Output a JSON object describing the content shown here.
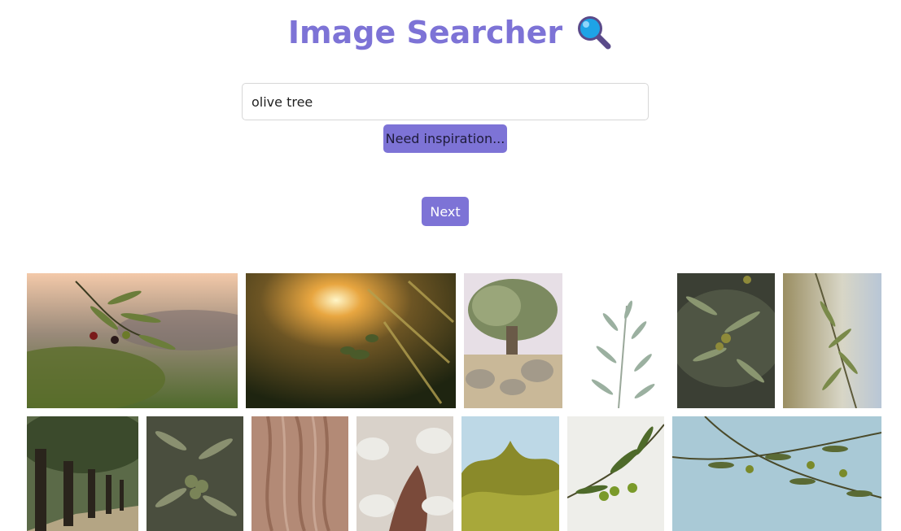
{
  "header": {
    "title": "Image Searcher",
    "title_icon": "magnifying-glass-icon"
  },
  "search": {
    "value": "olive tree",
    "placeholder": ""
  },
  "buttons": {
    "inspire_label": "Need inspiration...",
    "next_label": "Next"
  },
  "colors": {
    "accent": "#7d73d6"
  },
  "gallery": {
    "row1": [
      {
        "subject": "olive branch with berries, blurred mountains"
      },
      {
        "subject": "olive branches against sunset glow"
      },
      {
        "subject": "ancient olive tree among rocks"
      },
      {
        "subject": "olive sprig on white background"
      },
      {
        "subject": "olive branch with green olives, dark"
      },
      {
        "subject": "olive leaves in soft light"
      }
    ],
    "row2": [
      {
        "subject": "olive grove trunks lined path"
      },
      {
        "subject": "olive cluster among leaves"
      },
      {
        "subject": "olive tree bark close-up"
      },
      {
        "subject": "twisted olive trunk, pale foliage"
      },
      {
        "subject": "olive treetops against sky"
      },
      {
        "subject": "olive branch with green olives, white background"
      },
      {
        "subject": "olive branches against blue sky"
      }
    ]
  }
}
